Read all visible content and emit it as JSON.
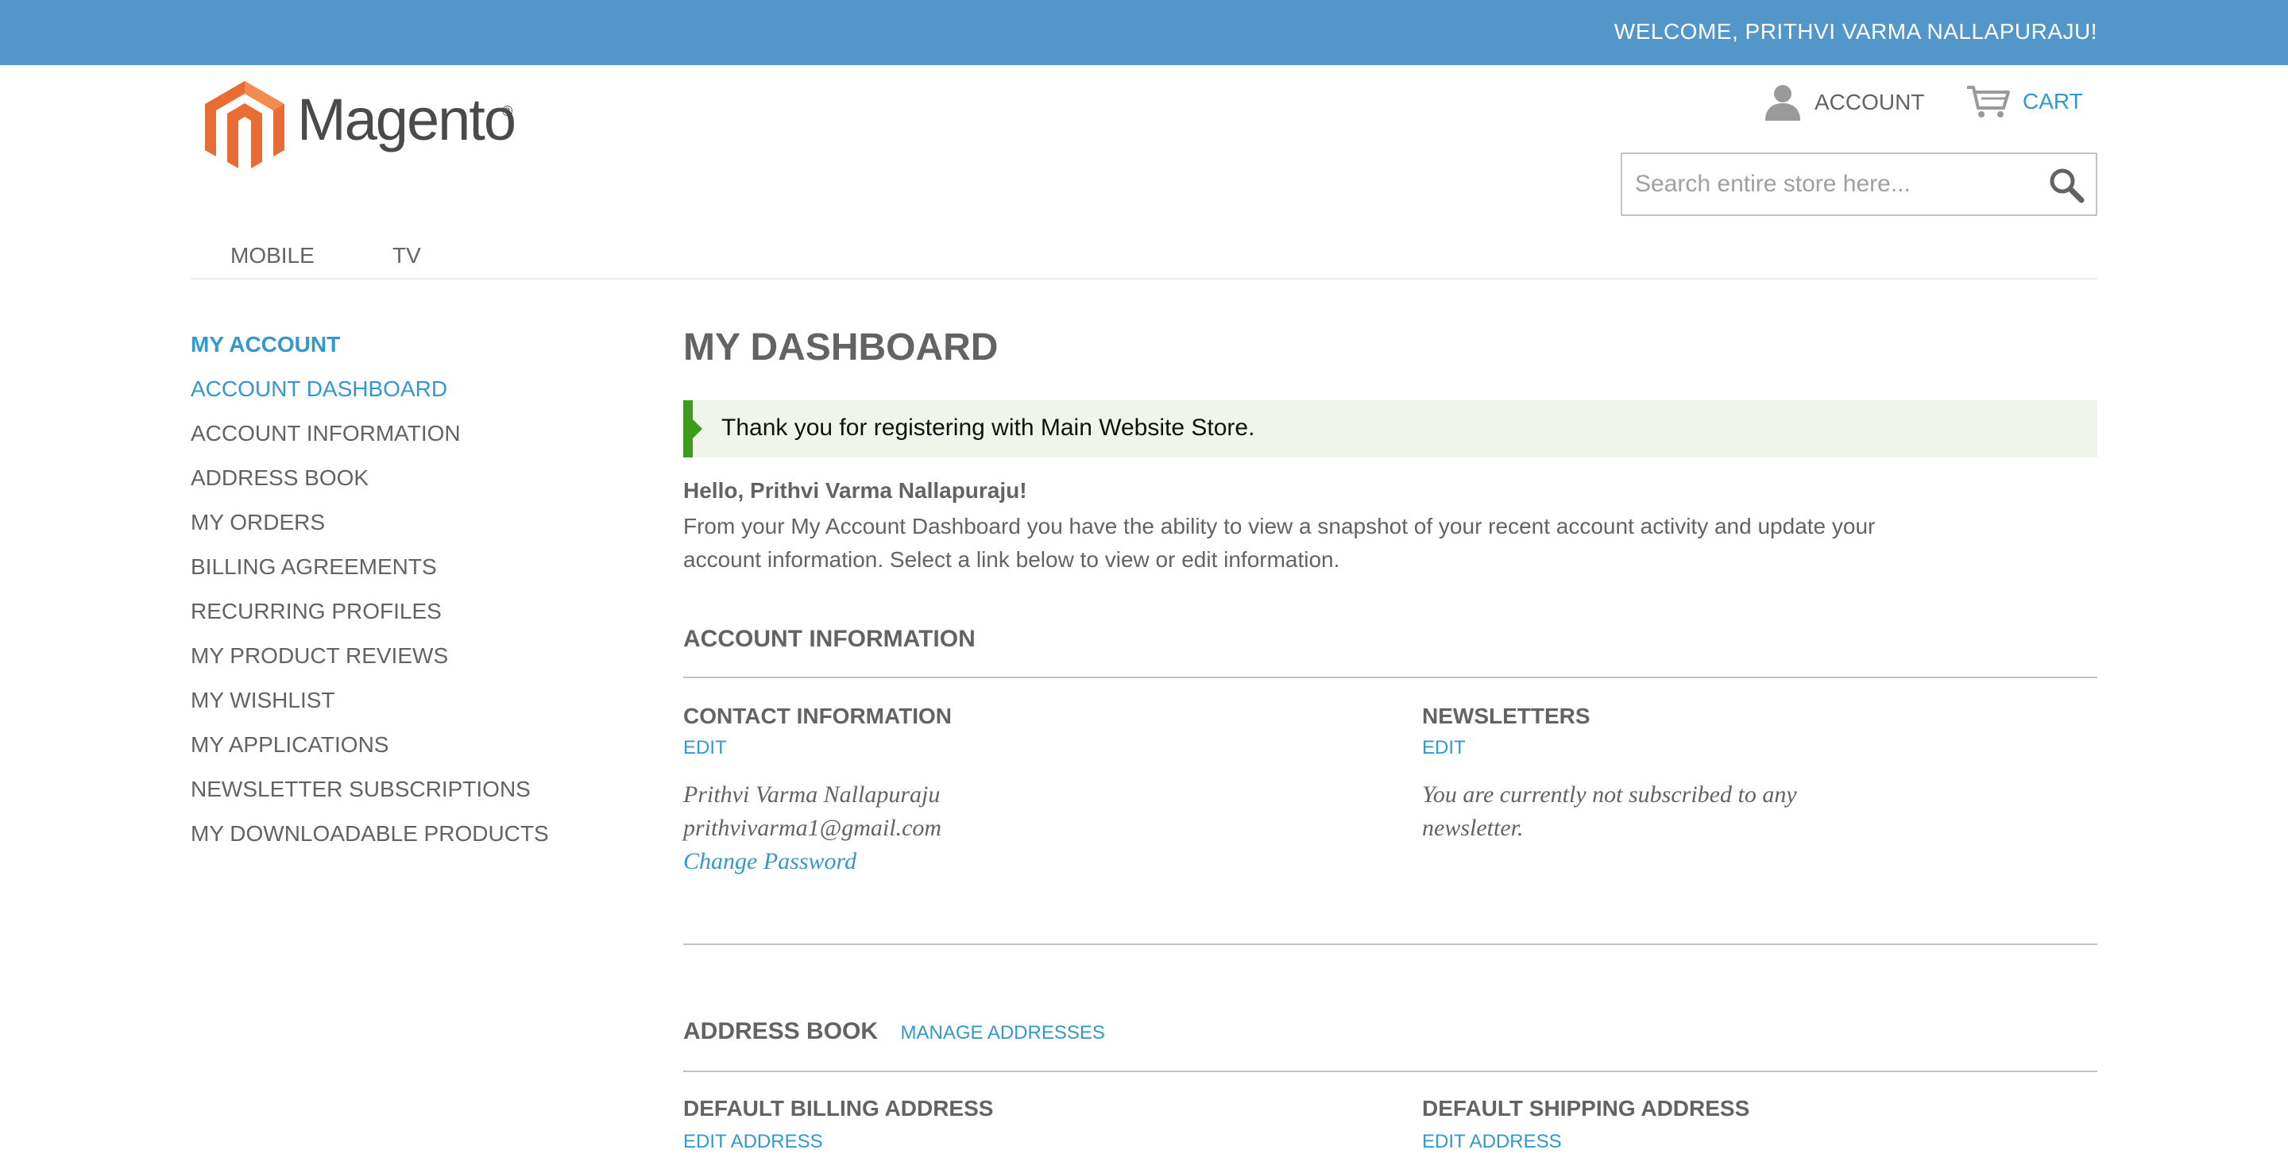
{
  "header": {
    "welcome": "WELCOME, PRITHVI VARMA NALLAPURAJU!",
    "logo_text": "Magento",
    "logo_mark": "®",
    "account_label": "ACCOUNT",
    "cart_label": "CART",
    "account_icon": "person-icon",
    "cart_icon": "cart-icon",
    "search_placeholder": "Search entire store here...",
    "search_icon": "magnifier-icon"
  },
  "nav": {
    "items": [
      "MOBILE",
      "TV"
    ]
  },
  "sidebar": {
    "title": "MY ACCOUNT",
    "items": [
      {
        "label": "ACCOUNT DASHBOARD",
        "active": true
      },
      {
        "label": "ACCOUNT INFORMATION"
      },
      {
        "label": "ADDRESS BOOK"
      },
      {
        "label": "MY ORDERS"
      },
      {
        "label": "BILLING AGREEMENTS"
      },
      {
        "label": "RECURRING PROFILES"
      },
      {
        "label": "MY PRODUCT REVIEWS"
      },
      {
        "label": "MY WISHLIST"
      },
      {
        "label": "MY APPLICATIONS"
      },
      {
        "label": "NEWSLETTER SUBSCRIPTIONS"
      },
      {
        "label": "MY DOWNLOADABLE PRODUCTS"
      }
    ]
  },
  "main": {
    "title": "MY DASHBOARD",
    "success_message": "Thank you for registering with Main Website Store.",
    "hello": "Hello, Prithvi Varma Nallapuraju!",
    "intro": "From your My Account Dashboard you have the ability to view a snapshot of your recent account activity and update your account information. Select a link below to view or edit information.",
    "account_info": {
      "title": "ACCOUNT INFORMATION",
      "contact": {
        "title": "CONTACT INFORMATION",
        "edit": "EDIT",
        "name": "Prithvi Varma Nallapuraju",
        "email": "prithvivarma1@gmail.com",
        "change_password": "Change Password"
      },
      "newsletters": {
        "title": "NEWSLETTERS",
        "edit": "EDIT",
        "line1": "You are currently not subscribed to any",
        "line2": "newsletter."
      }
    },
    "address_book": {
      "title": "ADDRESS BOOK",
      "manage": "MANAGE ADDRESSES",
      "billing": {
        "title": "DEFAULT BILLING ADDRESS",
        "edit": "EDIT ADDRESS"
      },
      "shipping": {
        "title": "DEFAULT SHIPPING ADDRESS",
        "edit": "EDIT ADDRESS"
      }
    }
  },
  "colors": {
    "topbar": "#5396c9",
    "link": "#3399cc",
    "text": "#636363",
    "success_bar": "#3d9c1e",
    "success_bg": "#eff5ea",
    "logo_orange": "#e96c34"
  }
}
